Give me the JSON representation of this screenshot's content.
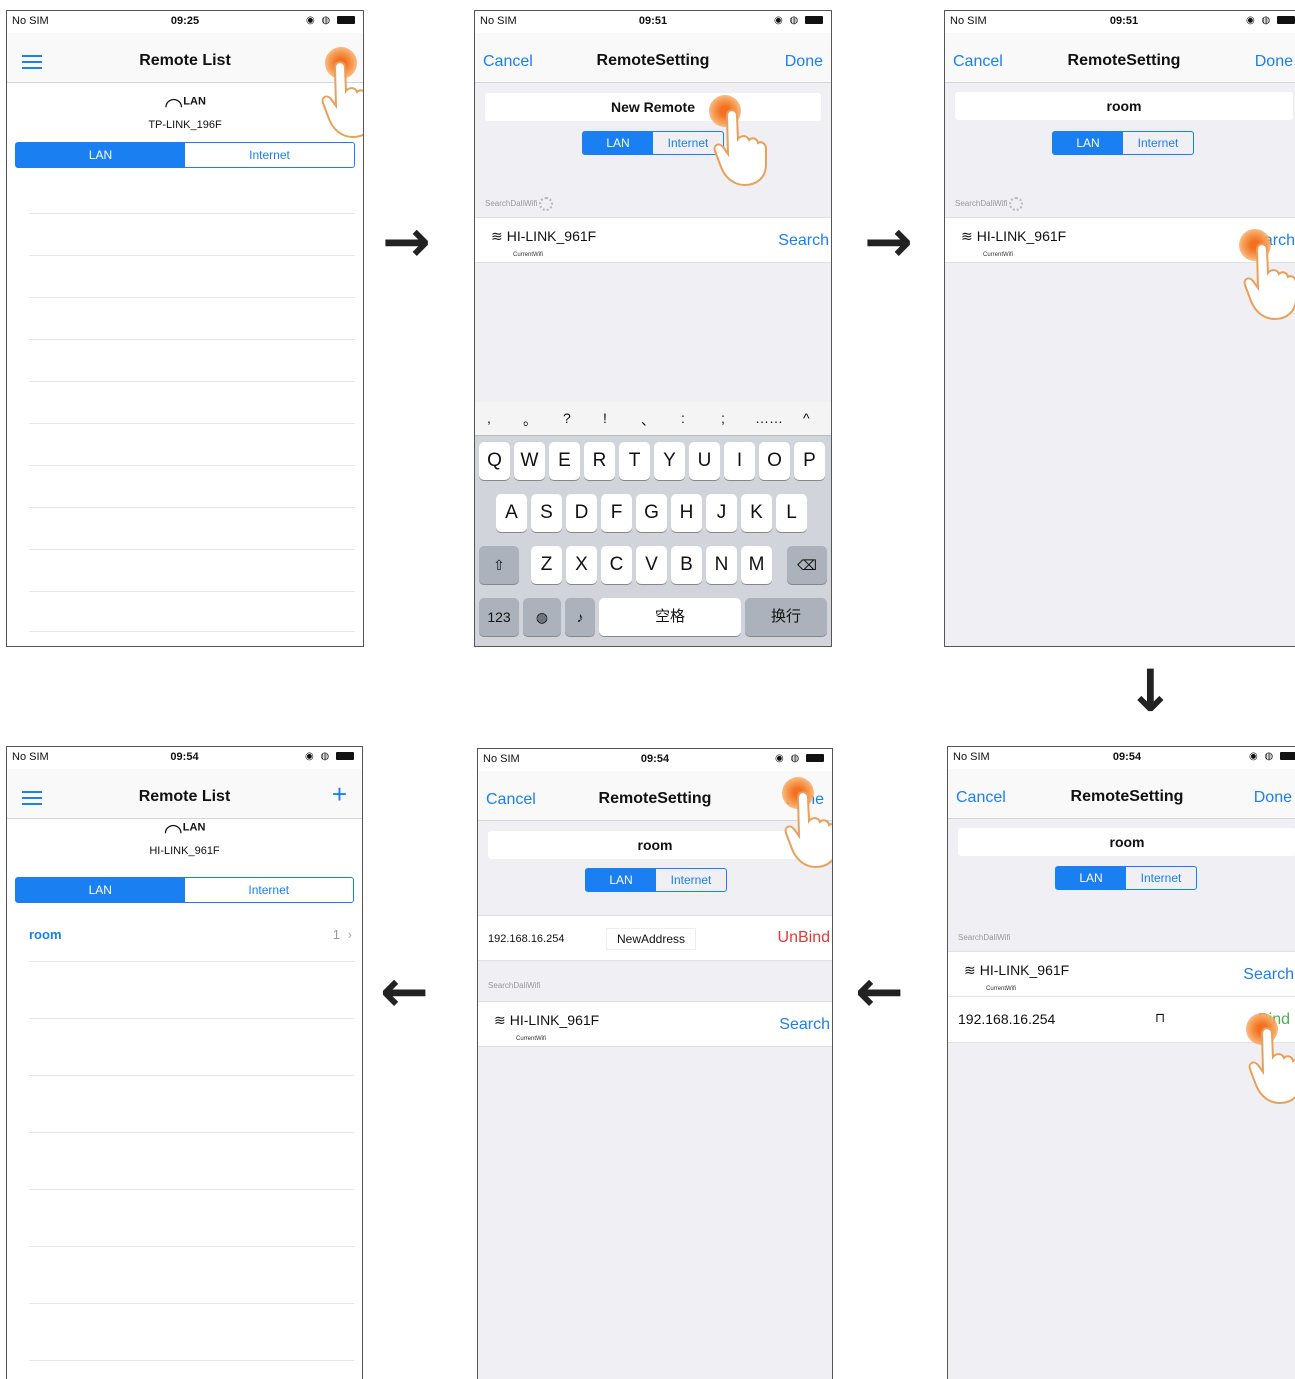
{
  "colors": {
    "accent": "#1a7ff0",
    "unbind": "#e53935",
    "bind": "#4caf50",
    "tap": "#f37021"
  },
  "screens": [
    {
      "status": {
        "carrier": "No SIM",
        "time": "09:25"
      },
      "nav": {
        "title": "Remote List"
      },
      "wifi": {
        "badge": "LAN",
        "ssid": "TP-LINK_196F"
      },
      "tabs": [
        "LAN",
        "Internet"
      ]
    },
    {
      "status": {
        "carrier": "No SIM",
        "time": "09:51"
      },
      "nav": {
        "left": "Cancel",
        "title": "RemoteSetting",
        "right": "Done"
      },
      "name_value": "New Remote",
      "tabs": [
        "LAN",
        "Internet"
      ],
      "section": "SearchDaliWifi",
      "wifi_row": {
        "ssid": "HI-LINK_961F",
        "sub": "CurrentWifi",
        "action": "Search"
      },
      "keyboard": {
        "symbols": [
          ",",
          "。",
          "?",
          "!",
          "、",
          ":",
          ";",
          "……",
          "^"
        ],
        "row1": [
          "Q",
          "W",
          "E",
          "R",
          "T",
          "Y",
          "U",
          "I",
          "O",
          "P"
        ],
        "row2": [
          "A",
          "S",
          "D",
          "F",
          "G",
          "H",
          "J",
          "K",
          "L"
        ],
        "row3": [
          "Z",
          "X",
          "C",
          "V",
          "B",
          "N",
          "M"
        ],
        "num": "123",
        "space": "空格",
        "return": "换行"
      }
    },
    {
      "status": {
        "carrier": "No SIM",
        "time": "09:51"
      },
      "nav": {
        "left": "Cancel",
        "title": "RemoteSetting",
        "right": "Done"
      },
      "name_value": "room",
      "tabs": [
        "LAN",
        "Internet"
      ],
      "section": "SearchDaliWifi",
      "wifi_row": {
        "ssid": "HI-LINK_961F",
        "sub": "CurrentWifi",
        "action": "Search"
      }
    },
    {
      "status": {
        "carrier": "No SIM",
        "time": "09:54"
      },
      "nav": {
        "title": "Remote List"
      },
      "wifi": {
        "badge": "LAN",
        "ssid": "HI-LINK_961F"
      },
      "tabs": [
        "LAN",
        "Internet"
      ],
      "remote": {
        "name": "room",
        "count": "1"
      }
    },
    {
      "status": {
        "carrier": "No SIM",
        "time": "09:54"
      },
      "nav": {
        "left": "Cancel",
        "title": "RemoteSetting",
        "right": "Done"
      },
      "name_value": "room",
      "tabs": [
        "LAN",
        "Internet"
      ],
      "bound": {
        "ip": "192.168.16.254",
        "address": "NewAddress",
        "action": "UnBind"
      },
      "section": "SearchDaliWifi",
      "wifi_row": {
        "ssid": "HI-LINK_961F",
        "sub": "CurrentWifi",
        "action": "Search"
      }
    },
    {
      "status": {
        "carrier": "No SIM",
        "time": "09:54"
      },
      "nav": {
        "left": "Cancel",
        "title": "RemoteSetting",
        "right": "Done"
      },
      "name_value": "room",
      "tabs": [
        "LAN",
        "Internet"
      ],
      "section": "SearchDaliWifi",
      "wifi_row": {
        "ssid": "HI-LINK_961F",
        "sub": "CurrentWifi",
        "action": "Search"
      },
      "device": {
        "ip": "192.168.16.254",
        "action": "Bind"
      }
    }
  ],
  "flow_arrows": [
    "→",
    "→",
    "↓",
    "←",
    "←"
  ]
}
